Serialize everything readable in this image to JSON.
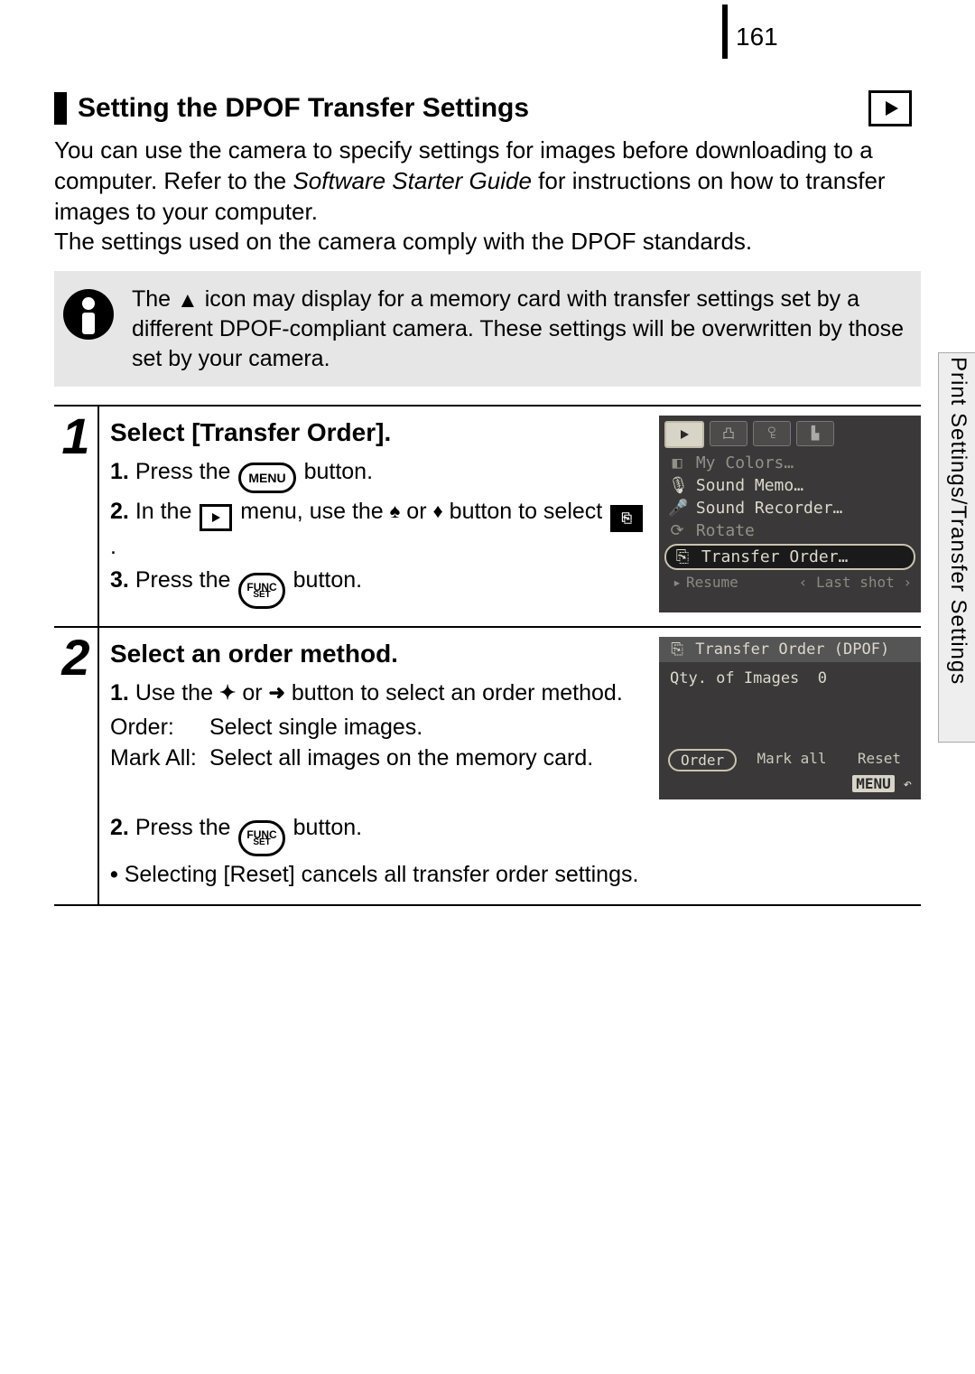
{
  "page_number": "161",
  "section_title": "Setting the DPOF Transfer Settings",
  "intro": {
    "line1": "You can use the camera to specify settings for images before downloading to a computer. Refer to the ",
    "italic": "Software Starter Guide",
    "line2": " for instructions on how to transfer images to your computer.",
    "line3": "The settings used on the camera comply with the DPOF standards."
  },
  "note": {
    "pre": "The ",
    "post": " icon may display for a memory card with transfer settings set by a different DPOF-compliant camera. These settings will be overwritten by those set by your camera."
  },
  "step1": {
    "num": "1",
    "title": "Select [Transfer Order].",
    "i1a": "Press the ",
    "i1b": " button.",
    "i2a": "In the ",
    "i2b": " menu, use the ",
    "i2c": " or ",
    "i2d": " button to select ",
    "i2e": ".",
    "i3a": "Press the ",
    "i3b": " button.",
    "n1": "1.",
    "n2": "2.",
    "n3": "3.",
    "menu_label": "MENU",
    "func_top": "FUNC",
    "func_bot": "SET"
  },
  "step2": {
    "num": "2",
    "title": "Select an order method.",
    "i1a": "Use the ",
    "i1b": " or ",
    "i1c": " button to select an order method.",
    "order_term": "Order:",
    "order_desc": "Select single images.",
    "mark_term": "Mark All:",
    "mark_desc": "Select all images on the memory card.",
    "i2a": "Press the ",
    "i2b": " button.",
    "bullet": "Selecting [Reset] cancels all transfer order settings.",
    "n1": "1.",
    "n2": "2.",
    "func_top": "FUNC",
    "func_bot": "SET"
  },
  "lcd1": {
    "my_colors": "My Colors…",
    "sound_memo": "Sound Memo…",
    "sound_recorder": "Sound Recorder…",
    "rotate": "Rotate",
    "transfer_order": "Transfer Order…",
    "resume": "Resume",
    "last_shot": "Last shot"
  },
  "lcd2": {
    "title": "Transfer Order (DPOF)",
    "qty_label": "Qty. of Images",
    "qty_value": "0",
    "btn_order": "Order",
    "btn_mark": "Mark all",
    "btn_reset": "Reset",
    "menu": "MENU"
  },
  "side_tab": "Print Settings/Transfer Settings"
}
